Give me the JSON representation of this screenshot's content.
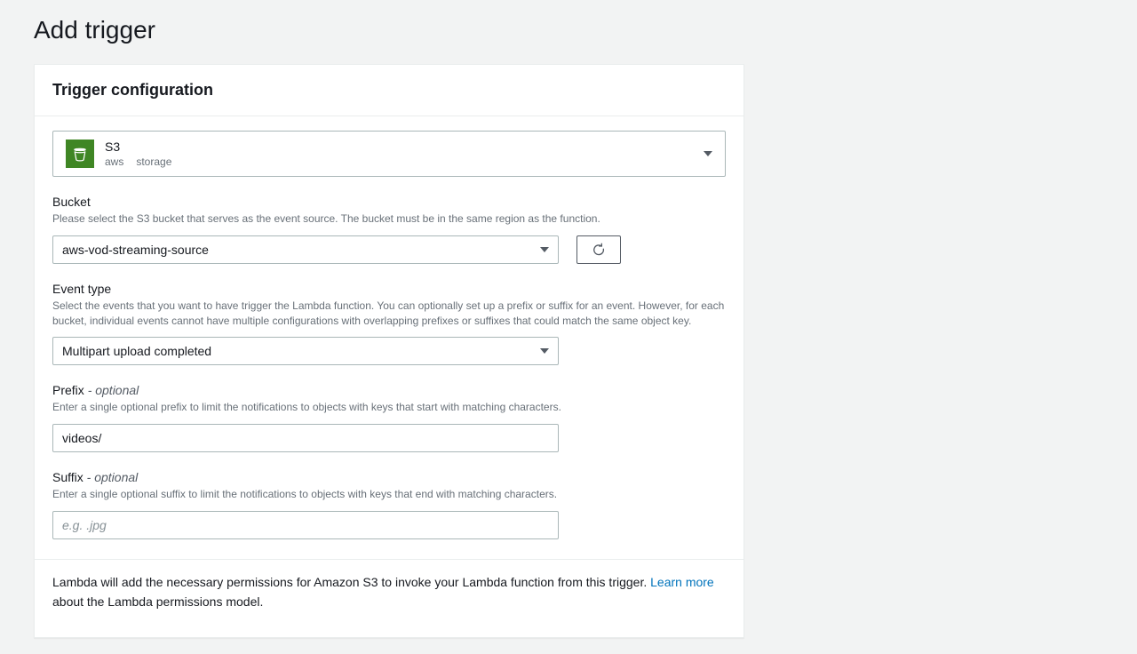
{
  "page": {
    "title": "Add trigger"
  },
  "card": {
    "heading": "Trigger configuration",
    "serviceSelect": {
      "name": "S3",
      "provider": "aws",
      "category": "storage"
    },
    "bucket": {
      "label": "Bucket",
      "hint": "Please select the S3 bucket that serves as the event source. The bucket must be in the same region as the function.",
      "value": "aws-vod-streaming-source"
    },
    "eventType": {
      "label": "Event type",
      "hint": "Select the events that you want to have trigger the Lambda function. You can optionally set up a prefix or suffix for an event. However, for each bucket, individual events cannot have multiple configurations with overlapping prefixes or suffixes that could match the same object key.",
      "value": "Multipart upload completed"
    },
    "prefix": {
      "label": "Prefix",
      "optional": "- optional",
      "hint": "Enter a single optional prefix to limit the notifications to objects with keys that start with matching characters.",
      "value": "videos/"
    },
    "suffix": {
      "label": "Suffix",
      "optional": "- optional",
      "hint": "Enter a single optional suffix to limit the notifications to objects with keys that end with matching characters.",
      "placeholder": "e.g. .jpg",
      "value": ""
    },
    "footer": {
      "part1": "Lambda will add the necessary permissions for Amazon S3 to invoke your Lambda function from this trigger. ",
      "link": "Learn more",
      "part2": " about the Lambda permissions model."
    }
  }
}
